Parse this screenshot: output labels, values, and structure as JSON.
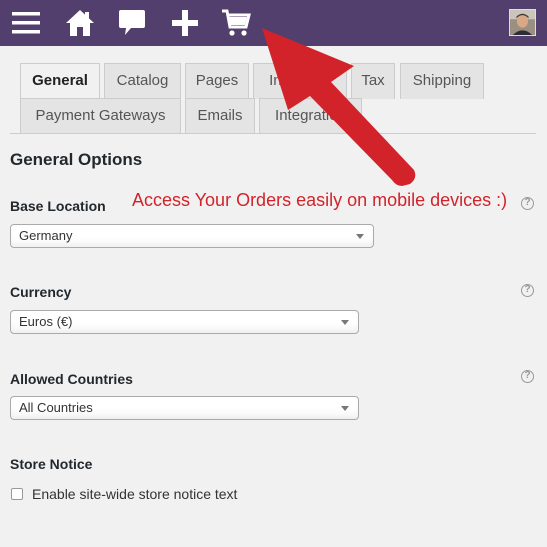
{
  "toolbar": {
    "icons": [
      "menu-icon",
      "home-icon",
      "comment-icon",
      "plus-icon",
      "cart-icon"
    ],
    "bg_color": "#523f6d"
  },
  "tabs": [
    {
      "label": "General",
      "active": true
    },
    {
      "label": "Catalog",
      "active": false
    },
    {
      "label": "Pages",
      "active": false
    },
    {
      "label": "Inventory",
      "active": false
    },
    {
      "label": "Tax",
      "active": false
    },
    {
      "label": "Shipping",
      "active": false
    },
    {
      "label": "Payment Gateways",
      "active": false
    },
    {
      "label": "Emails",
      "active": false
    },
    {
      "label": "Integration",
      "active": false
    }
  ],
  "section_title": "General Options",
  "fields": {
    "base_location": {
      "label": "Base Location",
      "value": "Germany"
    },
    "currency": {
      "label": "Currency",
      "value": "Euros (€)"
    },
    "allowed_countries": {
      "label": "Allowed Countries",
      "value": "All Countries"
    },
    "store_notice": {
      "label": "Store Notice",
      "checkbox_label": "Enable site-wide store notice text",
      "checked": false
    }
  },
  "help_glyph": "?",
  "annotation": {
    "text": "Access Your Orders easily on mobile devices :)",
    "color": "#d2232a"
  }
}
